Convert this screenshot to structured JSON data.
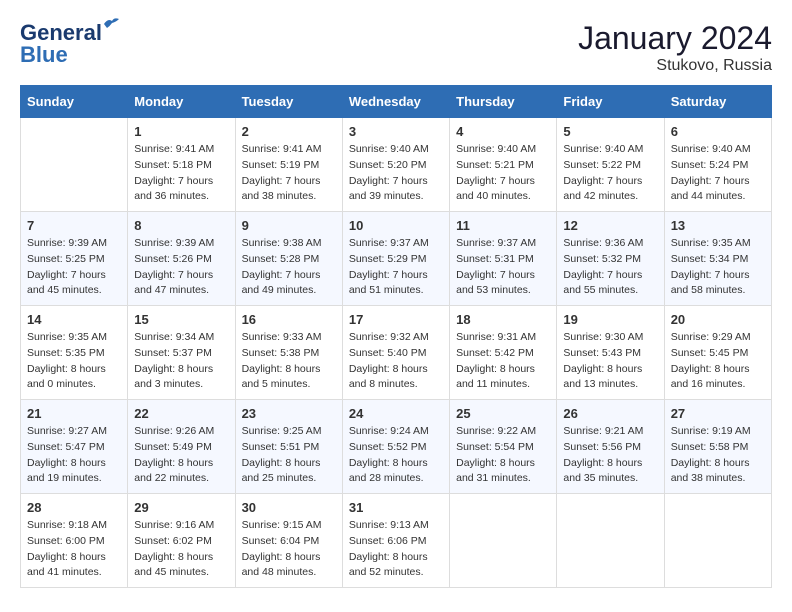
{
  "header": {
    "logo_line1": "General",
    "logo_line2": "Blue",
    "month_year": "January 2024",
    "location": "Stukovo, Russia"
  },
  "weekdays": [
    "Sunday",
    "Monday",
    "Tuesday",
    "Wednesday",
    "Thursday",
    "Friday",
    "Saturday"
  ],
  "weeks": [
    [
      {
        "day": "",
        "sunrise": "",
        "sunset": "",
        "daylight": ""
      },
      {
        "day": "1",
        "sunrise": "Sunrise: 9:41 AM",
        "sunset": "Sunset: 5:18 PM",
        "daylight": "Daylight: 7 hours and 36 minutes."
      },
      {
        "day": "2",
        "sunrise": "Sunrise: 9:41 AM",
        "sunset": "Sunset: 5:19 PM",
        "daylight": "Daylight: 7 hours and 38 minutes."
      },
      {
        "day": "3",
        "sunrise": "Sunrise: 9:40 AM",
        "sunset": "Sunset: 5:20 PM",
        "daylight": "Daylight: 7 hours and 39 minutes."
      },
      {
        "day": "4",
        "sunrise": "Sunrise: 9:40 AM",
        "sunset": "Sunset: 5:21 PM",
        "daylight": "Daylight: 7 hours and 40 minutes."
      },
      {
        "day": "5",
        "sunrise": "Sunrise: 9:40 AM",
        "sunset": "Sunset: 5:22 PM",
        "daylight": "Daylight: 7 hours and 42 minutes."
      },
      {
        "day": "6",
        "sunrise": "Sunrise: 9:40 AM",
        "sunset": "Sunset: 5:24 PM",
        "daylight": "Daylight: 7 hours and 44 minutes."
      }
    ],
    [
      {
        "day": "7",
        "sunrise": "Sunrise: 9:39 AM",
        "sunset": "Sunset: 5:25 PM",
        "daylight": "Daylight: 7 hours and 45 minutes."
      },
      {
        "day": "8",
        "sunrise": "Sunrise: 9:39 AM",
        "sunset": "Sunset: 5:26 PM",
        "daylight": "Daylight: 7 hours and 47 minutes."
      },
      {
        "day": "9",
        "sunrise": "Sunrise: 9:38 AM",
        "sunset": "Sunset: 5:28 PM",
        "daylight": "Daylight: 7 hours and 49 minutes."
      },
      {
        "day": "10",
        "sunrise": "Sunrise: 9:37 AM",
        "sunset": "Sunset: 5:29 PM",
        "daylight": "Daylight: 7 hours and 51 minutes."
      },
      {
        "day": "11",
        "sunrise": "Sunrise: 9:37 AM",
        "sunset": "Sunset: 5:31 PM",
        "daylight": "Daylight: 7 hours and 53 minutes."
      },
      {
        "day": "12",
        "sunrise": "Sunrise: 9:36 AM",
        "sunset": "Sunset: 5:32 PM",
        "daylight": "Daylight: 7 hours and 55 minutes."
      },
      {
        "day": "13",
        "sunrise": "Sunrise: 9:35 AM",
        "sunset": "Sunset: 5:34 PM",
        "daylight": "Daylight: 7 hours and 58 minutes."
      }
    ],
    [
      {
        "day": "14",
        "sunrise": "Sunrise: 9:35 AM",
        "sunset": "Sunset: 5:35 PM",
        "daylight": "Daylight: 8 hours and 0 minutes."
      },
      {
        "day": "15",
        "sunrise": "Sunrise: 9:34 AM",
        "sunset": "Sunset: 5:37 PM",
        "daylight": "Daylight: 8 hours and 3 minutes."
      },
      {
        "day": "16",
        "sunrise": "Sunrise: 9:33 AM",
        "sunset": "Sunset: 5:38 PM",
        "daylight": "Daylight: 8 hours and 5 minutes."
      },
      {
        "day": "17",
        "sunrise": "Sunrise: 9:32 AM",
        "sunset": "Sunset: 5:40 PM",
        "daylight": "Daylight: 8 hours and 8 minutes."
      },
      {
        "day": "18",
        "sunrise": "Sunrise: 9:31 AM",
        "sunset": "Sunset: 5:42 PM",
        "daylight": "Daylight: 8 hours and 11 minutes."
      },
      {
        "day": "19",
        "sunrise": "Sunrise: 9:30 AM",
        "sunset": "Sunset: 5:43 PM",
        "daylight": "Daylight: 8 hours and 13 minutes."
      },
      {
        "day": "20",
        "sunrise": "Sunrise: 9:29 AM",
        "sunset": "Sunset: 5:45 PM",
        "daylight": "Daylight: 8 hours and 16 minutes."
      }
    ],
    [
      {
        "day": "21",
        "sunrise": "Sunrise: 9:27 AM",
        "sunset": "Sunset: 5:47 PM",
        "daylight": "Daylight: 8 hours and 19 minutes."
      },
      {
        "day": "22",
        "sunrise": "Sunrise: 9:26 AM",
        "sunset": "Sunset: 5:49 PM",
        "daylight": "Daylight: 8 hours and 22 minutes."
      },
      {
        "day": "23",
        "sunrise": "Sunrise: 9:25 AM",
        "sunset": "Sunset: 5:51 PM",
        "daylight": "Daylight: 8 hours and 25 minutes."
      },
      {
        "day": "24",
        "sunrise": "Sunrise: 9:24 AM",
        "sunset": "Sunset: 5:52 PM",
        "daylight": "Daylight: 8 hours and 28 minutes."
      },
      {
        "day": "25",
        "sunrise": "Sunrise: 9:22 AM",
        "sunset": "Sunset: 5:54 PM",
        "daylight": "Daylight: 8 hours and 31 minutes."
      },
      {
        "day": "26",
        "sunrise": "Sunrise: 9:21 AM",
        "sunset": "Sunset: 5:56 PM",
        "daylight": "Daylight: 8 hours and 35 minutes."
      },
      {
        "day": "27",
        "sunrise": "Sunrise: 9:19 AM",
        "sunset": "Sunset: 5:58 PM",
        "daylight": "Daylight: 8 hours and 38 minutes."
      }
    ],
    [
      {
        "day": "28",
        "sunrise": "Sunrise: 9:18 AM",
        "sunset": "Sunset: 6:00 PM",
        "daylight": "Daylight: 8 hours and 41 minutes."
      },
      {
        "day": "29",
        "sunrise": "Sunrise: 9:16 AM",
        "sunset": "Sunset: 6:02 PM",
        "daylight": "Daylight: 8 hours and 45 minutes."
      },
      {
        "day": "30",
        "sunrise": "Sunrise: 9:15 AM",
        "sunset": "Sunset: 6:04 PM",
        "daylight": "Daylight: 8 hours and 48 minutes."
      },
      {
        "day": "31",
        "sunrise": "Sunrise: 9:13 AM",
        "sunset": "Sunset: 6:06 PM",
        "daylight": "Daylight: 8 hours and 52 minutes."
      },
      {
        "day": "",
        "sunrise": "",
        "sunset": "",
        "daylight": ""
      },
      {
        "day": "",
        "sunrise": "",
        "sunset": "",
        "daylight": ""
      },
      {
        "day": "",
        "sunrise": "",
        "sunset": "",
        "daylight": ""
      }
    ]
  ]
}
